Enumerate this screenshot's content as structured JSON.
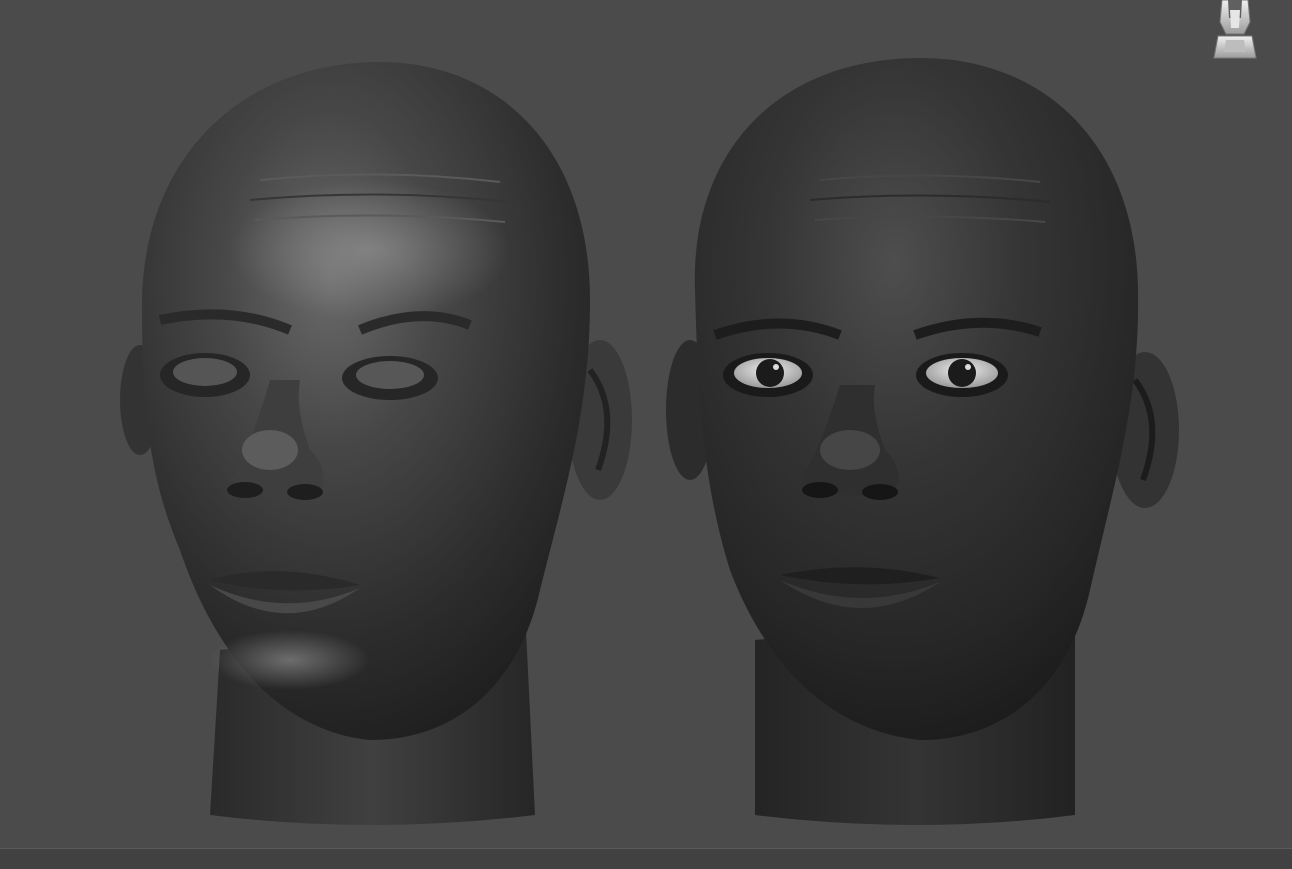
{
  "viewport": {
    "background_color": "#4b4b4b",
    "gizmo": {
      "icon": "navigation-cube-icon"
    },
    "models": [
      {
        "name": "sculpt-head-untextured",
        "material_color": "#3e3e3e",
        "eyes": "sculpted-shells"
      },
      {
        "name": "sculpt-head-with-eyes",
        "material_color": "#2f2f2f",
        "eyes": "rendered-eyeballs"
      }
    ]
  }
}
